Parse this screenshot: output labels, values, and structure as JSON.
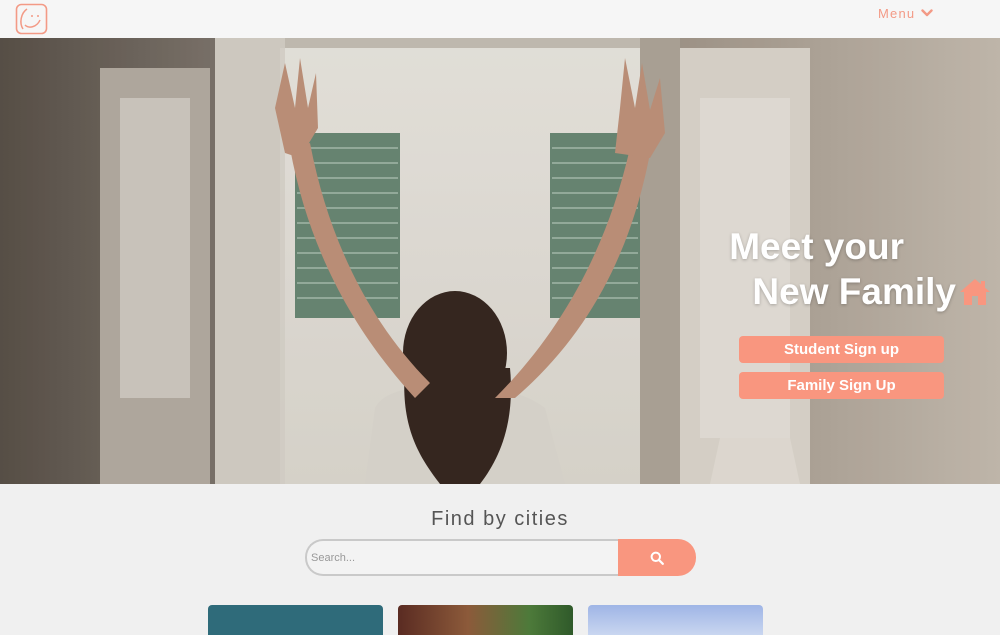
{
  "header": {
    "logo_icon": "smiley-logo-icon",
    "menu_label": "Menu",
    "menu_icon": "chevron-down-icon"
  },
  "hero": {
    "title_line1": "Meet your",
    "title_line2": "New Family",
    "title_icon": "home-icon",
    "student_signup_label": "Student Sign up",
    "family_signup_label": "Family Sign Up"
  },
  "search_section": {
    "title": "Find by cities",
    "placeholder": "Search...",
    "search_icon": "search-icon"
  },
  "cities": [
    {
      "name": "",
      "color": "#2f6b7a"
    },
    {
      "name": "",
      "color": "#8c5a3a"
    },
    {
      "name": "",
      "color": "#9fb5e6"
    }
  ],
  "colors": {
    "accent": "#f9967f",
    "menu_text": "#f39a86"
  }
}
